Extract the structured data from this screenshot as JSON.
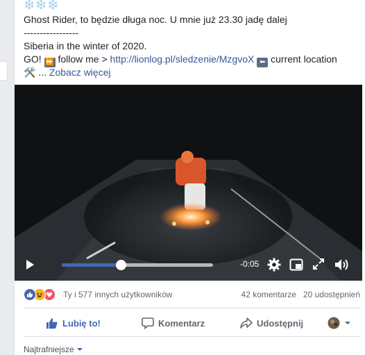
{
  "post": {
    "snow": "❄️❄️❄️",
    "line1": "Ghost Rider, to będzie długa noc. U mnie już 23.30 jadę dalej",
    "line2": "-----------------",
    "line3": "Siberia in the winter of 2020.",
    "go_prefix": "GO!",
    "ff_emoji": "⏩",
    "follow_text": "follow me >",
    "link_url": "http://lionlog.pl/sledzenie/MzgvoX",
    "back_emoji": "⬅",
    "location_text": "current location",
    "tools_emoji": "🛠️",
    "ellipsis": "...",
    "see_more": "Zobacz więcej"
  },
  "video": {
    "time": "-0:05",
    "progress": 0.39,
    "icons": [
      "play-icon",
      "gear-icon",
      "pip-icon",
      "fullscreen-icon",
      "volume-icon"
    ]
  },
  "reactions": {
    "icons": [
      "like-icon",
      "haha-icon",
      "love-icon"
    ],
    "text": "Ty i 577 innych użytkowników",
    "comments": "42 komentarze",
    "shares": "20 udostępnień",
    "colors": {
      "like": "#4267b2",
      "haha": "#f7b125",
      "love": "#f25268"
    }
  },
  "actions": {
    "like": "Lubię to!",
    "comment": "Komentarz",
    "share": "Udostępnij"
  },
  "comments": {
    "sort_label": "Najtrafniejsze"
  }
}
